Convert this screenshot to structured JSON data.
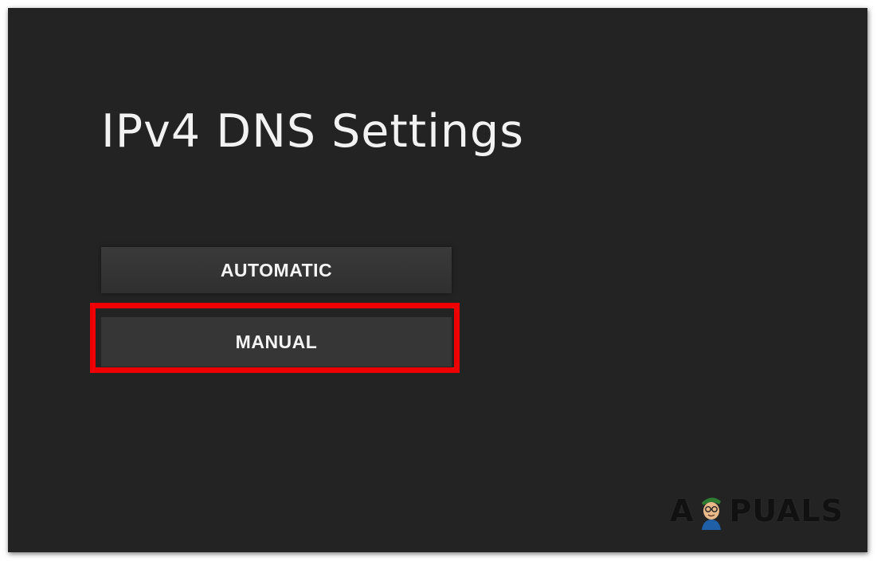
{
  "screen": {
    "title": "IPv4 DNS Settings"
  },
  "options": [
    {
      "label": "AUTOMATIC"
    },
    {
      "label": "MANUAL"
    }
  ],
  "annotation": {
    "highlight_color": "#ee0000",
    "highlighted_option": "MANUAL"
  },
  "watermark": {
    "text": "APPUALS",
    "left": "A",
    "right": "PUALS",
    "icon": "mascot-icon"
  },
  "colors": {
    "background": "#232323",
    "button": "#363636",
    "text": "#f2f2f2"
  }
}
